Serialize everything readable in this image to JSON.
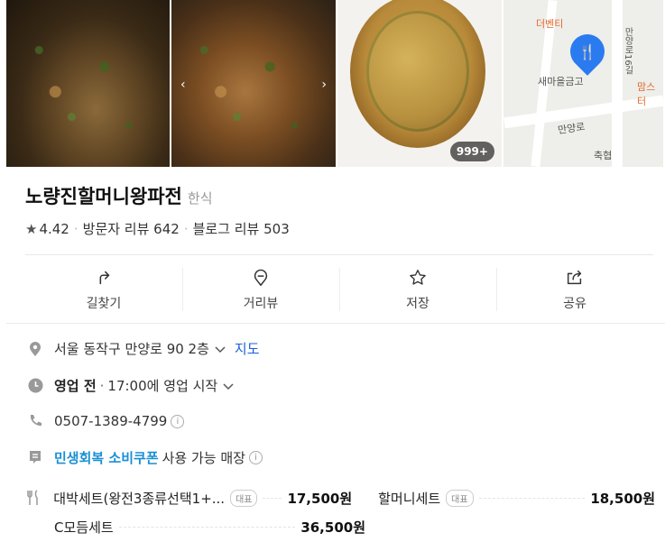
{
  "photos": {
    "count_badge": "999+"
  },
  "map": {
    "labels": {
      "place1": "더벤티",
      "place2": "새마을금고",
      "place3": "맘스터",
      "road1": "만양로16길",
      "road2": "만양로",
      "place4": "축협"
    }
  },
  "place": {
    "name": "노량진할머니왕파전",
    "category": "한식",
    "rating": "4.42",
    "visitor_reviews": "방문자 리뷰 642",
    "blog_reviews": "블로그 리뷰 503"
  },
  "actions": [
    {
      "label": "길찾기",
      "icon": "directions-icon"
    },
    {
      "label": "거리뷰",
      "icon": "streetview-icon"
    },
    {
      "label": "저장",
      "icon": "star-icon"
    },
    {
      "label": "공유",
      "icon": "share-icon"
    }
  ],
  "info": {
    "address": "서울 동작구 만양로 90 2층",
    "map_link": "지도",
    "status": "영업 전",
    "hours": "17:00에 영업 시작",
    "phone": "0507-1389-4799",
    "coupon": "민생회복 소비쿠폰",
    "coupon_suffix": "사용 가능 매장"
  },
  "menu": [
    {
      "name": "대박세트(왕전3종류선택1+...",
      "badge": "대표",
      "price": "17,500원"
    },
    {
      "name": "할머니세트",
      "badge": "대표",
      "price": "18,500원"
    },
    {
      "name": "C모듬세트",
      "badge": "",
      "price": "36,500원"
    }
  ],
  "colors": {
    "link": "#1a5fd6",
    "coupon": "#1a8fd6",
    "pin": "#2b7bf0"
  }
}
